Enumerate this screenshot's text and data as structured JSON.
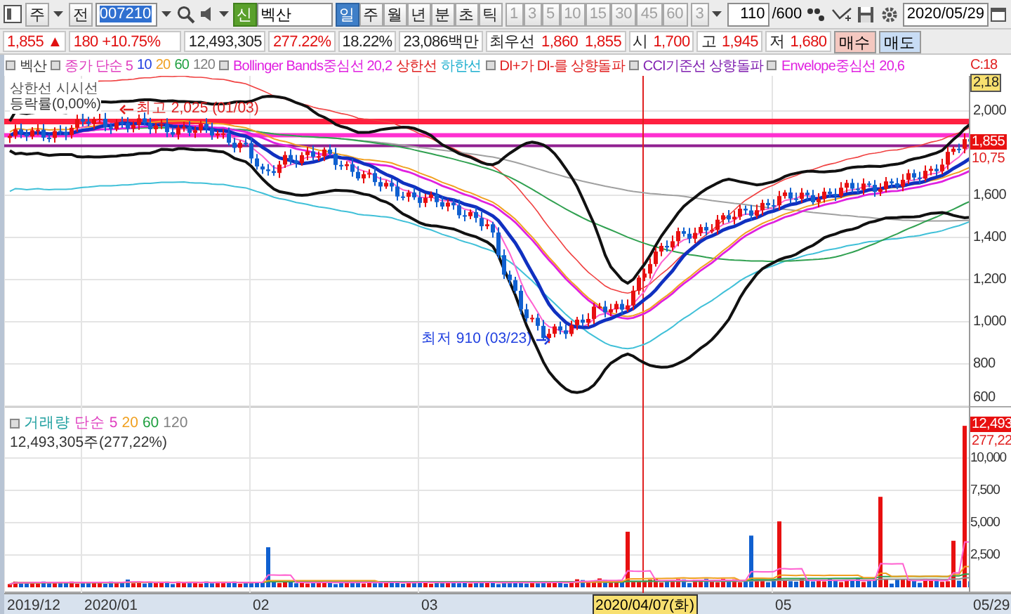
{
  "toolbar": {
    "market": "주",
    "scope": "전",
    "code": "007210",
    "badge": "신",
    "name": "벡산",
    "periods": [
      {
        "label": "일",
        "selected": true
      },
      {
        "label": "주",
        "selected": false
      },
      {
        "label": "월",
        "selected": false
      },
      {
        "label": "년",
        "selected": false
      },
      {
        "label": "분",
        "selected": false
      },
      {
        "label": "초",
        "selected": false
      },
      {
        "label": "틱",
        "selected": false
      }
    ],
    "minutes": [
      {
        "label": "1",
        "disabled": true
      },
      {
        "label": "3",
        "disabled": true
      },
      {
        "label": "5",
        "disabled": true
      },
      {
        "label": "10",
        "disabled": true
      },
      {
        "label": "15",
        "disabled": true
      },
      {
        "label": "30",
        "disabled": true
      },
      {
        "label": "45",
        "disabled": true
      },
      {
        "label": "60",
        "disabled": true
      }
    ],
    "interval": {
      "value": "3",
      "disabled": true
    },
    "count": "110",
    "count_max": "/600",
    "date": "2020/05/29"
  },
  "quote": {
    "price": "1,855 ▲",
    "change": "180 +10.75%",
    "volume": "12,493,305",
    "volume_ratio": "277.22%",
    "turnover": "18.22%",
    "amount": "23,086백만",
    "best_label": "최우선",
    "ask": "1,860",
    "bid": "1,855",
    "open_label": "시",
    "open": "1,700",
    "high_label": "고",
    "high": "1,945",
    "low_label": "저",
    "low": "1,680",
    "buy": "매수",
    "sell": "매도"
  },
  "price_legend": [
    {
      "items": [
        {
          "text": "벡산",
          "color": "#404040"
        }
      ]
    },
    {
      "items": [
        {
          "text": "종가 단순 5",
          "color": "#e040c0"
        },
        {
          "text": "10",
          "color": "#2040e0"
        },
        {
          "text": "20",
          "color": "#f0a020"
        },
        {
          "text": "60",
          "color": "#20a040"
        },
        {
          "text": "120",
          "color": "#808080"
        }
      ]
    },
    {
      "items": [
        {
          "text": "Bollinger Bands중심선 20,2",
          "color": "#e020e0"
        },
        {
          "text": "상한선",
          "color": "#e02020"
        },
        {
          "text": "하한선",
          "color": "#20b0d0"
        }
      ]
    },
    {
      "items": [
        {
          "text": "DI+가 DI-를 상향돌파",
          "color": "#e02020"
        }
      ]
    },
    {
      "items": [
        {
          "text": "CCI기준선 상향돌파",
          "color": "#8020b0"
        }
      ]
    },
    {
      "items": [
        {
          "text": "Envelope중심선 20,6",
          "color": "#e020e0"
        }
      ]
    }
  ],
  "price_panel": {
    "corner_tag": "C:18",
    "top_tag": "2,18",
    "overlay_lines": [
      "상한선 시시선",
      "등락률(0,00%)"
    ],
    "high_label": "최고 2,025 (01/03)",
    "low_label": "최저 910 (03/23)",
    "axis": [
      "2,000",
      "1,600",
      "1,400",
      "1,200",
      "1,000",
      "800",
      "600"
    ],
    "price_tag": "1,855",
    "change_tag": "10,75"
  },
  "volume_panel": {
    "legend": [
      {
        "text": "거래량",
        "color": "#20a0a0"
      },
      {
        "text": "단순 5",
        "color": "#e040c0"
      },
      {
        "text": "20",
        "color": "#f0a020"
      },
      {
        "text": "60",
        "color": "#20a040"
      },
      {
        "text": "120",
        "color": "#808080"
      }
    ],
    "summary": "12,493,305주(277,22%)",
    "axis": [
      "10,000",
      "7,500",
      "5,000",
      "2,500"
    ],
    "volume_tag": "12,493",
    "ratio_tag": "277,22"
  },
  "date_axis": {
    "labels": [
      "2019/12",
      "2020/01",
      "02",
      "03",
      "05"
    ],
    "cursor_date": "2020/04/07(화)",
    "end_date": "05/29"
  }
}
